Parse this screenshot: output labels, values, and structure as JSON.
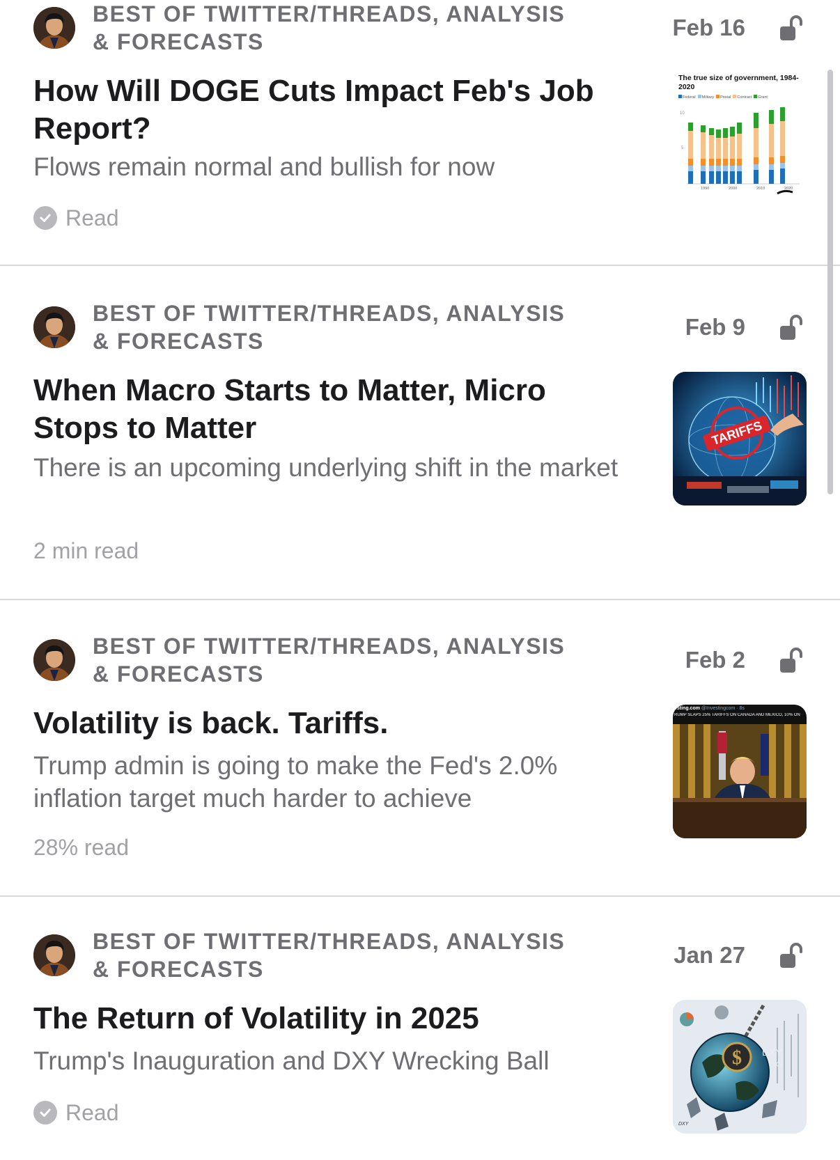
{
  "articles": [
    {
      "publication": "BEST OF TWITTER/THREADS, ANALYSIS & FORECASTS",
      "date": "Feb 16",
      "title": "How Will DOGE Cuts Impact Feb's Job Report?",
      "subtitle": "Flows remain normal and bullish for now",
      "status": "Read",
      "status_icon": "check-circle-icon",
      "lock_icon": "unlocked-padlock-icon",
      "thumb": {
        "kind": "chart",
        "title": "The true size of government, 1984-2020",
        "legend": [
          "Federal",
          "Military",
          "Postal",
          "Contract",
          "Grant"
        ],
        "legend_colors": [
          "#1f6fb8",
          "#9dc3e6",
          "#f28e2b",
          "#f6c28b",
          "#2ca02c"
        ],
        "x_ticks": [
          "1990",
          "2000",
          "2010",
          "2020"
        ],
        "y_ticks": [
          "10",
          "5"
        ]
      }
    },
    {
      "publication": "BEST OF TWITTER/THREADS, ANALYSIS & FORECASTS",
      "date": "Feb 9",
      "title": "When Macro Starts to Matter, Micro Stops to Matter",
      "subtitle": "There is an upcoming underlying shift in the market",
      "status": "2 min read",
      "status_icon": "",
      "lock_icon": "unlocked-padlock-icon",
      "thumb": {
        "kind": "tariffs",
        "stamp": "TARIFFS"
      }
    },
    {
      "publication": "BEST OF TWITTER/THREADS, ANALYSIS & FORECASTS",
      "date": "Feb 2",
      "title": "Volatility is back. Tariffs.",
      "subtitle": "Trump admin is going to make the Fed's 2.0% inflation target much harder to achieve",
      "status": "28% read",
      "status_icon": "",
      "lock_icon": "unlocked-padlock-icon",
      "thumb": {
        "kind": "news",
        "handle": "esting.com",
        "handle_suffix": "@Investingcom · 8s",
        "headline": "RUMP SLAPS 25% TARIFFS ON CANADA AND MEXICO, 10% ON"
      }
    },
    {
      "publication": "BEST OF TWITTER/THREADS, ANALYSIS & FORECASTS",
      "date": "Jan 27",
      "title": "The Return of Volatility in 2025",
      "subtitle": "Trump's Inauguration and DXY Wrecking Ball",
      "status": "Read",
      "status_icon": "check-circle-icon",
      "lock_icon": "unlocked-padlock-icon",
      "thumb": {
        "kind": "wrecking-ball",
        "labels": [
          "DXY",
          "DXY",
          "DXY"
        ]
      }
    }
  ],
  "colors": {
    "primary_text": "#1c1c1e",
    "secondary_text": "#6e6e73",
    "tertiary_text": "#a1a1a6",
    "divider": "#d9d9dc"
  }
}
